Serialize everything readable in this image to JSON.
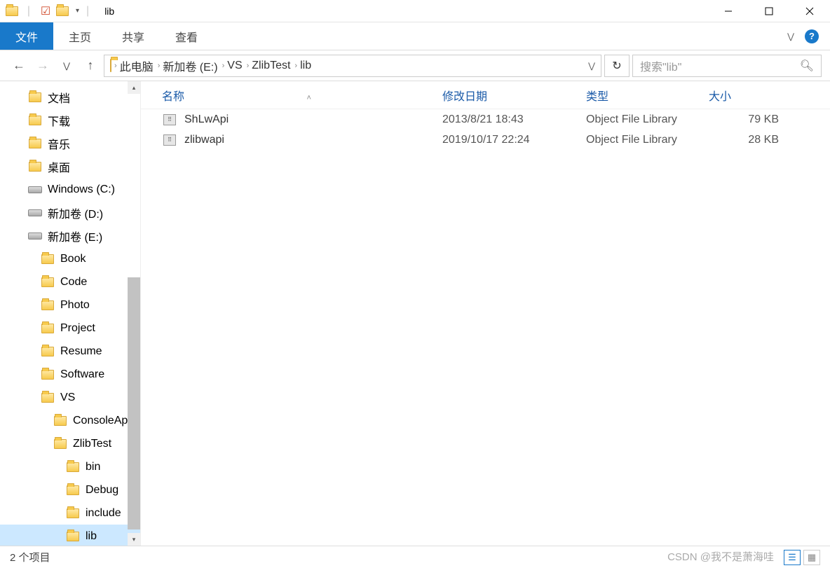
{
  "window": {
    "title": "lib"
  },
  "ribbon": {
    "file": "文件",
    "home": "主页",
    "share": "共享",
    "view": "查看"
  },
  "breadcrumb": {
    "items": [
      "此电脑",
      "新加卷 (E:)",
      "VS",
      "ZlibTest",
      "lib"
    ]
  },
  "search": {
    "placeholder": "搜索\"lib\""
  },
  "columns": {
    "name": "名称",
    "date": "修改日期",
    "type": "类型",
    "size": "大小"
  },
  "files": [
    {
      "name": "ShLwApi",
      "date": "2013/8/21 18:43",
      "type": "Object File Library",
      "size": "79 KB"
    },
    {
      "name": "zlibwapi",
      "date": "2019/10/17 22:24",
      "type": "Object File Library",
      "size": "28 KB"
    }
  ],
  "tree": [
    {
      "label": "文档",
      "indent": 40,
      "icon": "folder-blue"
    },
    {
      "label": "下载",
      "indent": 40,
      "icon": "folder-blue"
    },
    {
      "label": "音乐",
      "indent": 40,
      "icon": "folder-blue"
    },
    {
      "label": "桌面",
      "indent": 40,
      "icon": "folder-blue"
    },
    {
      "label": "Windows (C:)",
      "indent": 40,
      "icon": "drive"
    },
    {
      "label": "新加卷 (D:)",
      "indent": 40,
      "icon": "drive"
    },
    {
      "label": "新加卷 (E:)",
      "indent": 40,
      "icon": "drive"
    },
    {
      "label": "Book",
      "indent": 58,
      "icon": "folder"
    },
    {
      "label": "Code",
      "indent": 58,
      "icon": "folder"
    },
    {
      "label": "Photo",
      "indent": 58,
      "icon": "folder"
    },
    {
      "label": "Project",
      "indent": 58,
      "icon": "folder"
    },
    {
      "label": "Resume",
      "indent": 58,
      "icon": "folder"
    },
    {
      "label": "Software",
      "indent": 58,
      "icon": "folder"
    },
    {
      "label": "VS",
      "indent": 58,
      "icon": "folder"
    },
    {
      "label": "ConsoleApp",
      "indent": 76,
      "icon": "folder"
    },
    {
      "label": "ZlibTest",
      "indent": 76,
      "icon": "folder"
    },
    {
      "label": "bin",
      "indent": 94,
      "icon": "folder"
    },
    {
      "label": "Debug",
      "indent": 94,
      "icon": "folder"
    },
    {
      "label": "include",
      "indent": 94,
      "icon": "folder"
    },
    {
      "label": "lib",
      "indent": 94,
      "icon": "folder",
      "selected": true
    }
  ],
  "status": {
    "count": "2 个项目"
  },
  "watermark": "CSDN @我不是萧海哇"
}
